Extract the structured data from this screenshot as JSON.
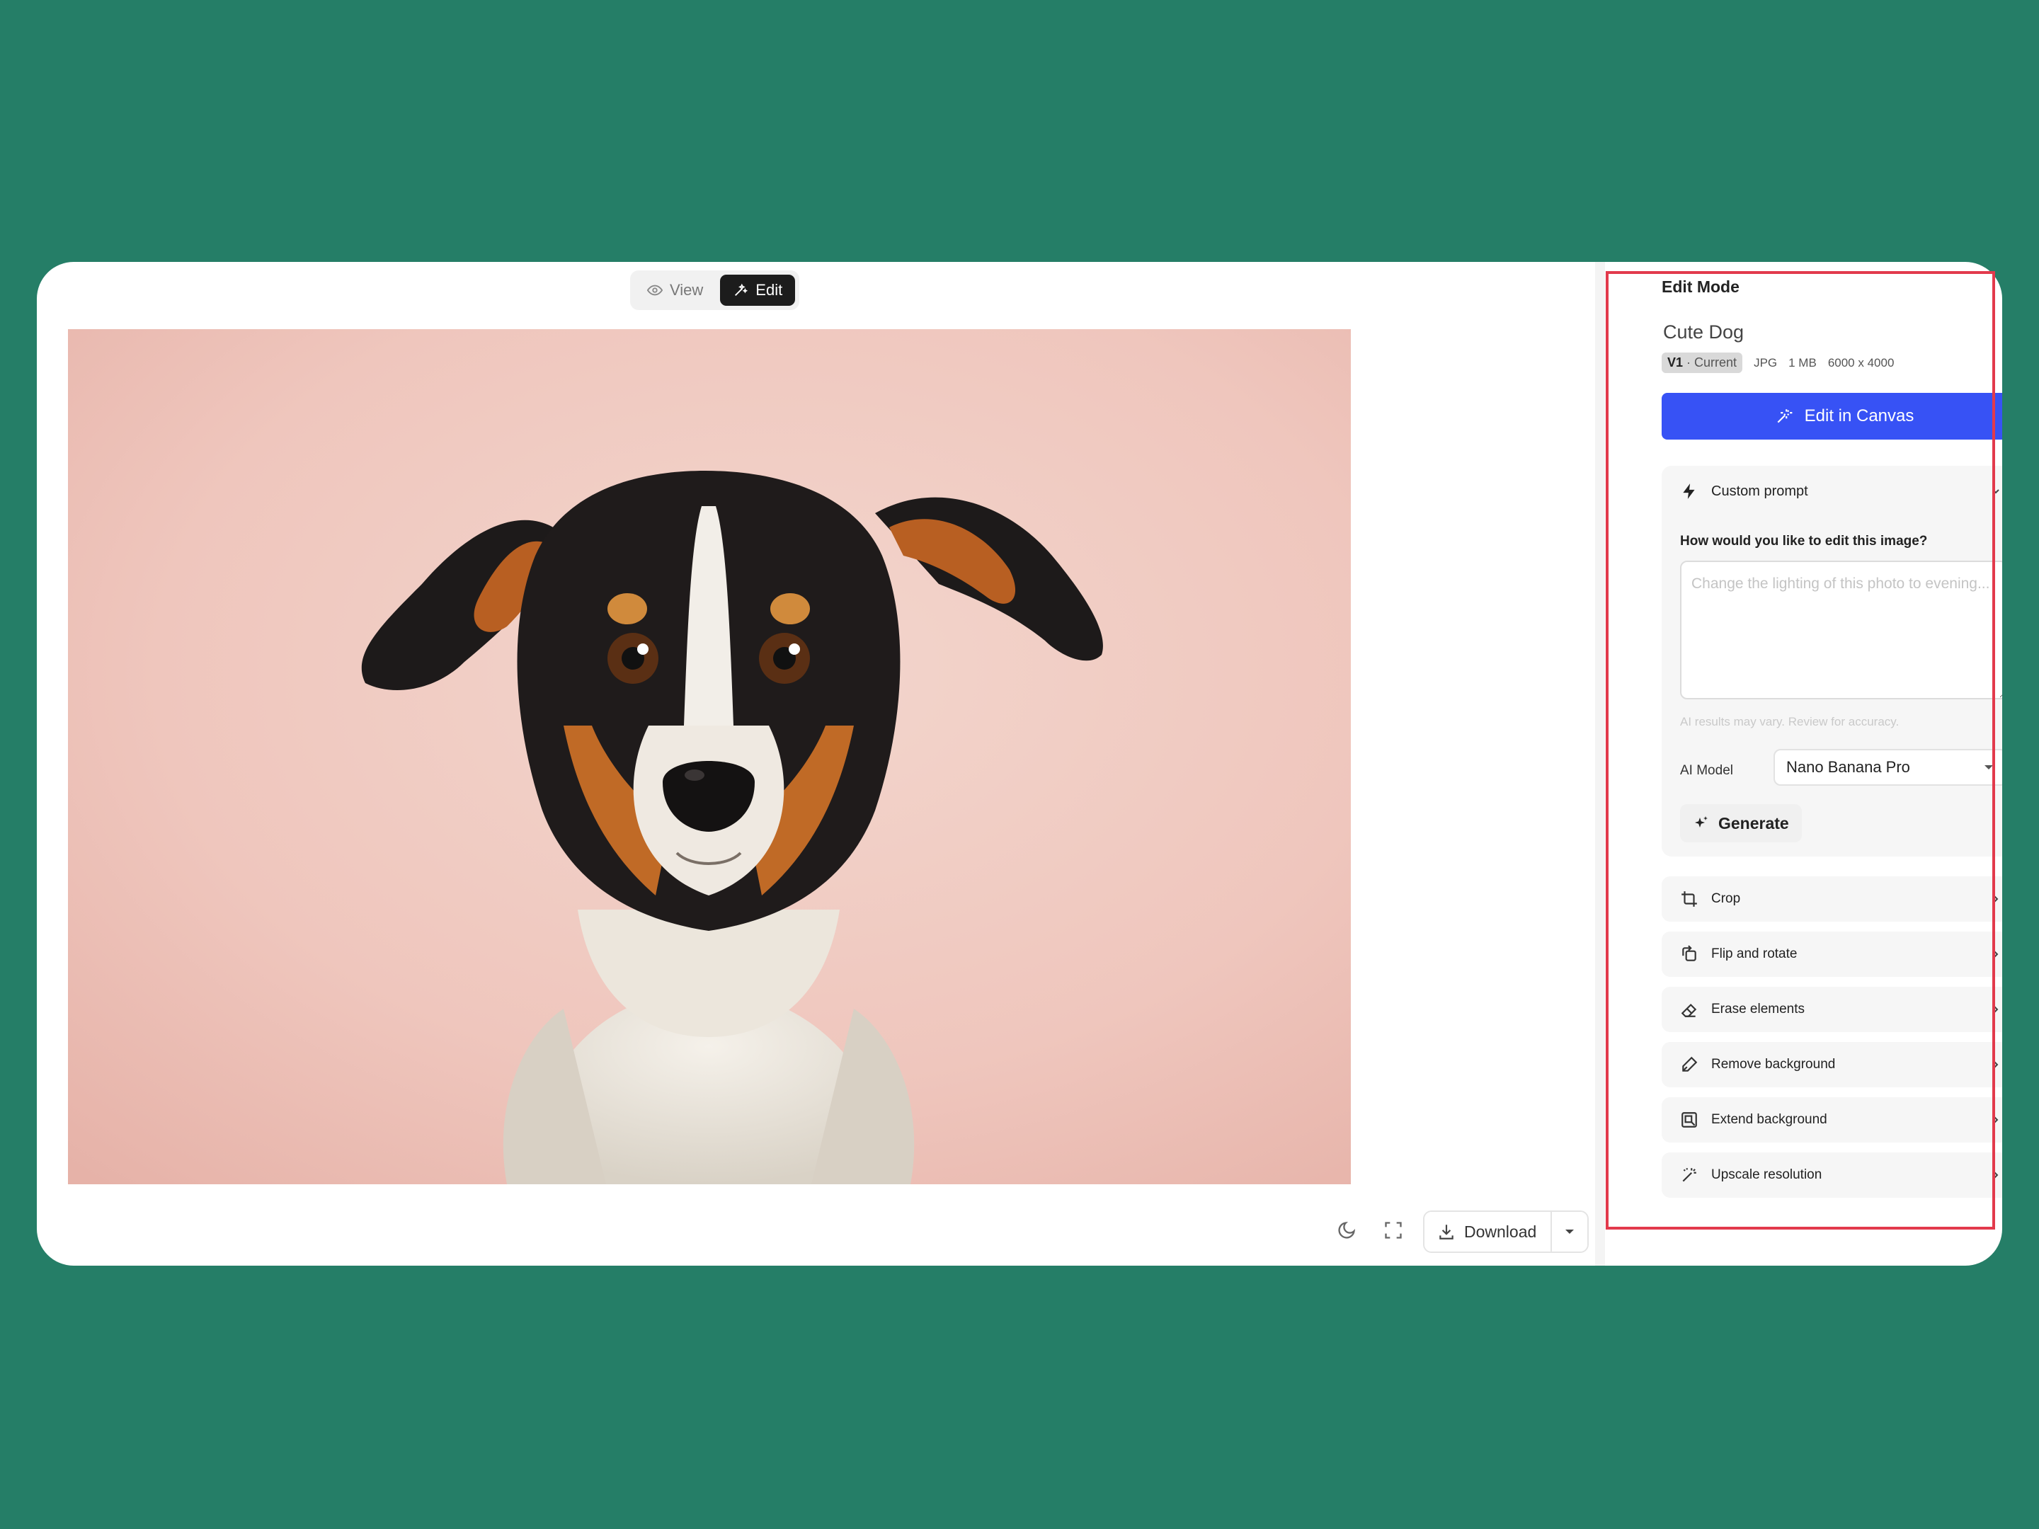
{
  "toggle": {
    "view_label": "View",
    "edit_label": "Edit",
    "active": "edit"
  },
  "photo": {
    "subject": "dog-portrait"
  },
  "toolbar": {
    "download_label": "Download"
  },
  "panel": {
    "heading": "Edit Mode",
    "file": {
      "title": "Cute Dog",
      "version": "V1",
      "version_status": "· Current",
      "format": "JPG",
      "size": "1 MB",
      "dimensions": "6000 x 4000"
    },
    "edit_canvas_label": "Edit in Canvas",
    "custom_prompt": {
      "label": "Custom prompt",
      "question": "How would you like to edit this image?",
      "placeholder": "Change the lighting of this photo to evening...",
      "value": "",
      "disclaimer": "AI results may vary. Review for accuracy.",
      "model_label": "AI Model",
      "model_value": "Nano Banana Pro",
      "generate_label": "Generate"
    },
    "tools": [
      {
        "label": "Crop",
        "icon": "crop-icon"
      },
      {
        "label": "Flip and rotate",
        "icon": "flip-rotate-icon"
      },
      {
        "label": "Erase elements",
        "icon": "eraser-icon"
      },
      {
        "label": "Remove background",
        "icon": "pen-icon"
      },
      {
        "label": "Extend background",
        "icon": "extend-icon"
      },
      {
        "label": "Upscale resolution",
        "icon": "magic-wand-icon"
      }
    ]
  },
  "colors": {
    "background": "#257e67",
    "accent": "#3752f5",
    "highlight": "#e23a4c"
  }
}
